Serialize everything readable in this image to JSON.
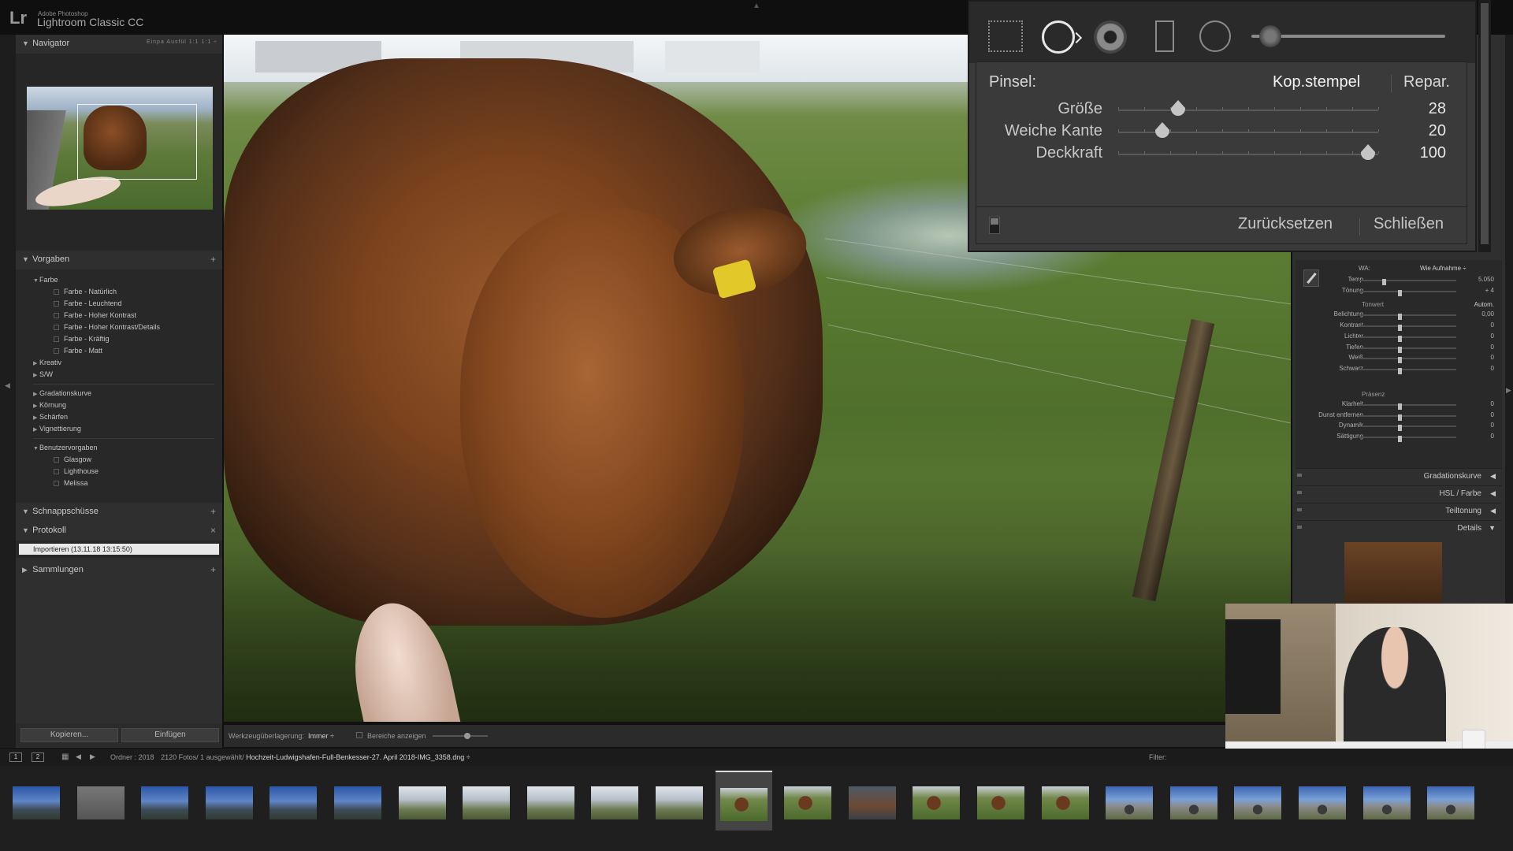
{
  "app": {
    "vendor": "Adobe Photoshop",
    "title": "Lightroom Classic CC",
    "logo": "Lr"
  },
  "navigator": {
    "title": "Navigator",
    "modes": "Einpa  Ausfül  1:1  1:1 ÷"
  },
  "presets": {
    "title": "Vorgaben",
    "groups": [
      {
        "name": "Farbe",
        "expanded": true,
        "items": [
          "Farbe - Natürlich",
          "Farbe - Leuchtend",
          "Farbe - Hoher Kontrast",
          "Farbe - Hoher Kontrast/Details",
          "Farbe - Kräftig",
          "Farbe - Matt"
        ]
      },
      {
        "name": "Kreativ",
        "expanded": false
      },
      {
        "name": "S/W",
        "expanded": false
      },
      {
        "name": "Gradationskurve",
        "expanded": false
      },
      {
        "name": "Körnung",
        "expanded": false
      },
      {
        "name": "Schärfen",
        "expanded": false
      },
      {
        "name": "Vignettierung",
        "expanded": false
      },
      {
        "name": "Benutzervorgaben",
        "expanded": true,
        "items": [
          "Glasgow",
          "Lighthouse",
          "Melissa"
        ]
      }
    ]
  },
  "snapshots": {
    "title": "Schnappschüsse"
  },
  "history": {
    "title": "Protokoll",
    "items": [
      "Importieren (13.11.18 13:15:50)"
    ]
  },
  "collections": {
    "title": "Sammlungen"
  },
  "left_buttons": {
    "copy": "Kopieren...",
    "paste": "Einfügen"
  },
  "toolbar": {
    "overlay_label": "Werkzeugüberlagerung:",
    "overlay_value": "Immer ÷",
    "show_areas": "Bereiche anzeigen"
  },
  "brush_panel": {
    "label": "Pinsel:",
    "mode_clone": "Kop.stempel",
    "mode_heal": "Repar.",
    "sliders": [
      {
        "name": "Größe",
        "value": "28",
        "fraction": 0.28
      },
      {
        "name": "Weiche Kante",
        "value": "20",
        "fraction": 0.2
      },
      {
        "name": "Deckkraft",
        "value": "100",
        "fraction": 1.0
      }
    ],
    "reset": "Zurücksetzen",
    "close": "Schließen"
  },
  "basic_panel": {
    "wb_label": "WA:",
    "wb_value": "Wie Aufnahme ÷",
    "rows1": [
      {
        "name": "Temp",
        "value": "5.050",
        "fraction": 0.26
      },
      {
        "name": "Tönung",
        "value": "+ 4",
        "fraction": 0.42
      }
    ],
    "tone_label": "Tonwert",
    "auto": "Autom.",
    "rows2": [
      {
        "name": "Belichtung",
        "value": "0,00",
        "fraction": 0.42
      },
      {
        "name": "Kontrast",
        "value": "0",
        "fraction": 0.42
      }
    ],
    "rows3": [
      {
        "name": "Lichter",
        "value": "0",
        "fraction": 0.42
      },
      {
        "name": "Tiefen",
        "value": "0",
        "fraction": 0.42
      },
      {
        "name": "Weiß",
        "value": "0",
        "fraction": 0.42
      },
      {
        "name": "Schwarz",
        "value": "0",
        "fraction": 0.42
      }
    ],
    "presence_label": "Präsenz",
    "rows4": [
      {
        "name": "Klarheit",
        "value": "0",
        "fraction": 0.42
      },
      {
        "name": "Dunst entfernen",
        "value": "0",
        "fraction": 0.42
      },
      {
        "name": "Dynamik",
        "value": "0",
        "fraction": 0.42
      },
      {
        "name": "Sättigung",
        "value": "0",
        "fraction": 0.42
      }
    ],
    "sections": [
      "Gradationskurve",
      "HSL / Farbe",
      "Teiltonung",
      "Details"
    ]
  },
  "filmstrip": {
    "page1": "1",
    "page2": "2",
    "folder": "Ordner : 2018",
    "count": "2120 Fotos/ 1 ausgewählt/",
    "file": "Hochzeit-Ludwigshafen-Full-Benkesser-27. April 2018-IMG_3358.dng ÷",
    "filter": "Filter:",
    "thumbs": [
      "sky1",
      "gray",
      "sky1",
      "sky1",
      "sky1",
      "sky1",
      "sky2",
      "sky2",
      "sky2",
      "sky2",
      "sky2",
      "cowt",
      "cowt",
      "portrait",
      "cowt",
      "cowt",
      "cowt",
      "road",
      "road",
      "road",
      "road",
      "road",
      "road"
    ],
    "selected_index": 11
  }
}
